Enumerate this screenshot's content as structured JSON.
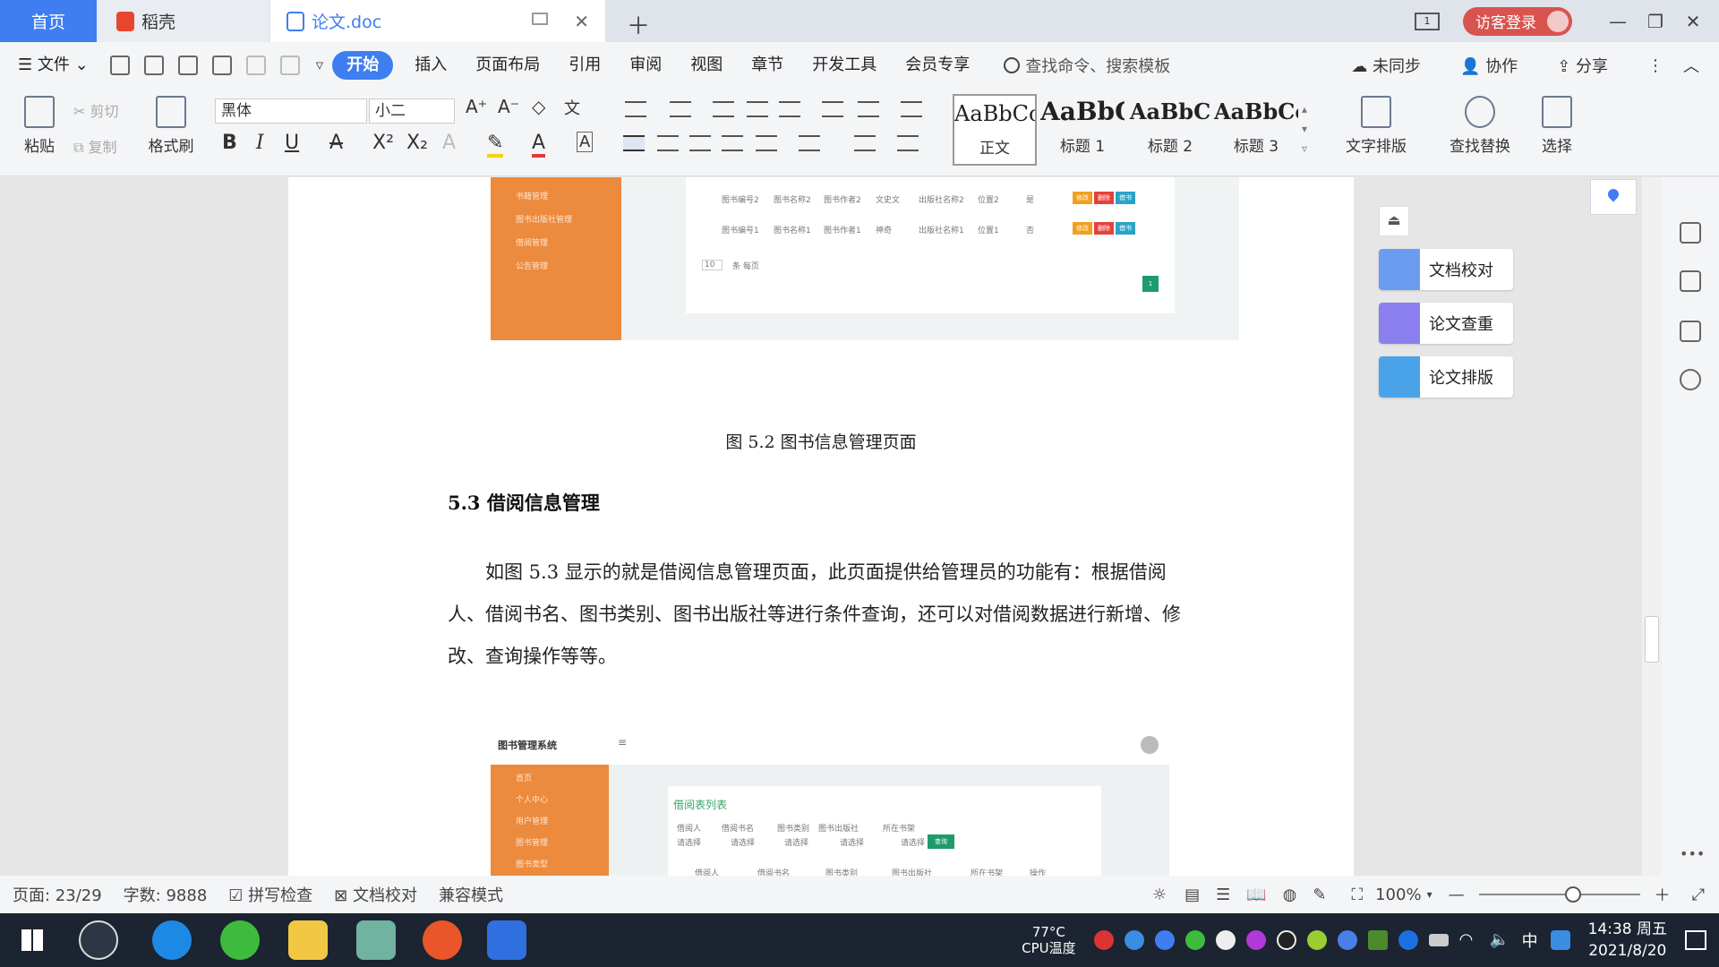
{
  "tabs": {
    "home": "首页",
    "daoke": "稻壳",
    "doc": "论文.doc",
    "guest_login": "访客登录"
  },
  "menu": {
    "file": "文件",
    "items": [
      "开始",
      "插入",
      "页面布局",
      "引用",
      "审阅",
      "视图",
      "章节",
      "开发工具",
      "会员专享"
    ],
    "search_placeholder": "查找命令、搜索模板",
    "unsync": "未同步",
    "collab": "协作",
    "share": "分享"
  },
  "ribbon": {
    "paste": "粘贴",
    "cut": "剪切",
    "copy": "复制",
    "format_painter": "格式刷",
    "font_name": "黑体",
    "font_size": "小二",
    "style_sample": "AaBbCcI",
    "style_sample_h1": "AaBbC",
    "style_sample_h2": "AaBbC",
    "style_sample_h3": "AaBbCcl",
    "style_body": "正文",
    "style_h1": "标题 1",
    "style_h2": "标题 2",
    "style_h3": "标题 3",
    "text_layout": "文字排版",
    "find_replace": "查找替换",
    "select": "选择"
  },
  "document": {
    "caption": "图 5.2  图书信息管理页面",
    "section_heading": "5.3 借阅信息管理",
    "paragraph": "如图 5.3 显示的就是借阅信息管理页面，此页面提供给管理员的功能有：根据借阅人、借阅书名、图书类别、图书出版社等进行条件查询，还可以对借阅数据进行新增、修改、查询操作等等。",
    "shot1": {
      "sidebar_items": [
        "书籍管理",
        "图书出版社管理",
        "借阅管理",
        "公告管理"
      ],
      "row1": [
        "图书编号2",
        "图书名称2",
        "图书作者2",
        "文史文",
        "出版社名称2",
        "位置2",
        "是"
      ],
      "row2": [
        "图书编号1",
        "图书名称1",
        "图书作者1",
        "神奇",
        "出版社名称1",
        "位置1",
        "否"
      ],
      "btn_edit": "修改",
      "btn_delete": "删除",
      "btn_borrow": "借书",
      "page_size": "10",
      "per_page": "条 每页",
      "page_num": "1"
    },
    "shot2": {
      "system_title": "图书管理系统",
      "sidebar_items": [
        "首页",
        "个人中心",
        "用户管理",
        "图书管理",
        "图书类型"
      ],
      "list_title": "借阅表列表",
      "filters": [
        "借阅人",
        "借阅书名",
        "图书类别",
        "图书出版社",
        "所在书架"
      ],
      "select_placeholder": "请选择",
      "query_btn": "查询",
      "columns": [
        "借阅人",
        "借阅书名",
        "图书类别",
        "图书出版社",
        "所在书架",
        "操作"
      ]
    }
  },
  "side_panel": {
    "proofread": "文档校对",
    "check_dup": "论文查重",
    "layout": "论文排版"
  },
  "status": {
    "page": "页面: 23/29",
    "words": "字数: 9888",
    "spell": "拼写检查",
    "proof": "文档校对",
    "compat": "兼容模式",
    "zoom": "100%"
  },
  "taskbar": {
    "temp": "77°C",
    "temp_label": "CPU温度",
    "ime": "中",
    "time": "14:38 周五",
    "date": "2021/8/20"
  },
  "colors": {
    "accent": "#3e7ef0",
    "sidebar_orange": "#ec8a3e",
    "guest_red": "#d9534f",
    "side_icon": "#6b9cf0"
  }
}
